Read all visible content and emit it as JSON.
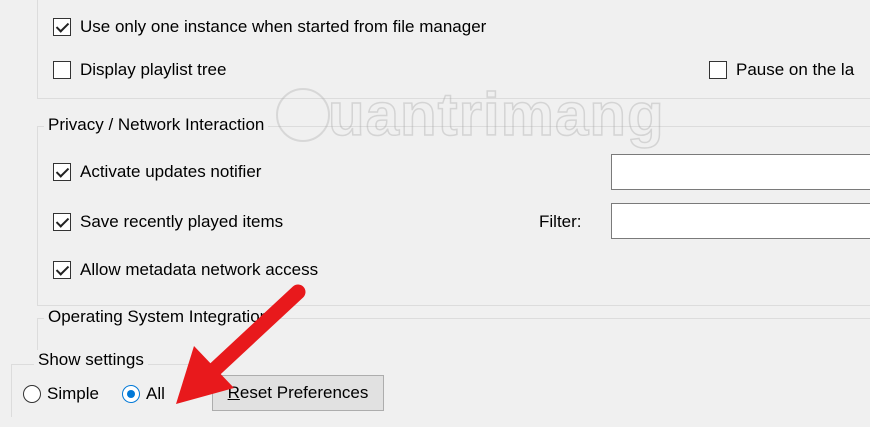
{
  "interface_group": {
    "one_instance": {
      "label": "Use only one instance when started from file manager",
      "checked": true
    },
    "playlist_tree": {
      "label": "Display playlist tree",
      "checked": false
    },
    "pause_last": {
      "label": "Pause on the la",
      "checked": false
    }
  },
  "privacy_group": {
    "title": "Privacy / Network Interaction",
    "updates_notifier": {
      "label": "Activate updates notifier",
      "checked": true
    },
    "recent_items": {
      "label": "Save recently played items",
      "checked": true
    },
    "filter_label": "Filter:",
    "metadata_access": {
      "label": "Allow metadata network access",
      "checked": true
    }
  },
  "os_group": {
    "title": "Operating System Integration"
  },
  "show_settings": {
    "title": "Show settings",
    "simple": {
      "label": "Simple",
      "selected": false
    },
    "all": {
      "label": "All",
      "selected": true
    }
  },
  "reset_button": {
    "accel": "R",
    "label_rest": "eset Preferences"
  },
  "watermark": {
    "text": "uantrimang"
  },
  "annotation": {
    "color": "#e8191c"
  }
}
